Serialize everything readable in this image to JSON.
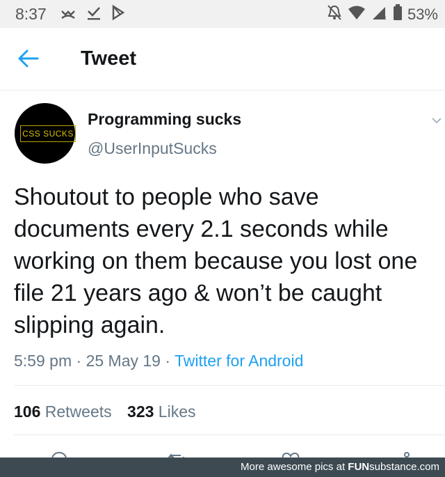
{
  "status_bar": {
    "time": "8:37",
    "battery": "53%"
  },
  "header": {
    "title": "Tweet"
  },
  "tweet": {
    "avatar_text": "CSS SUCKS",
    "display_name": "Programming sucks",
    "handle": "@UserInputSucks",
    "text": "Shoutout to people who save documents every 2.1 seconds while working on them because you lost one file 21 years ago & won’t be caught slipping again.",
    "time": "5:59 pm",
    "separator": "·",
    "date": "25 May 19",
    "source": "Twitter for Android"
  },
  "stats": {
    "retweets_count": "106",
    "retweets_label": "Retweets",
    "likes_count": "323",
    "likes_label": "Likes"
  },
  "footer": {
    "text": "More awesome pics at ",
    "brand_bold": "FUN",
    "brand_rest": "substance.com"
  },
  "colors": {
    "accent": "#1da1f2",
    "secondary_text": "#657786",
    "footer_bg": "#3d4a52"
  }
}
